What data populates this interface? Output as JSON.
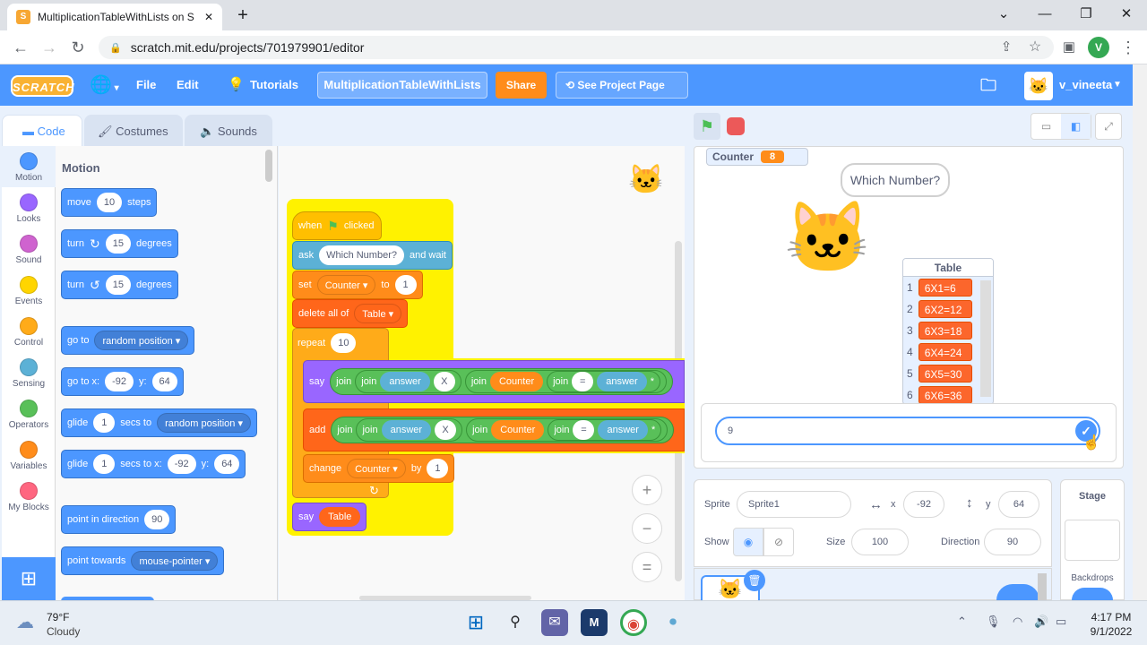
{
  "browser": {
    "tab_title": "MultiplicationTableWithLists on S",
    "tab_close": "✕",
    "new_tab": "+",
    "url": "scratch.mit.edu/projects/701979901/editor",
    "profile_initial": "V",
    "window_controls": [
      "⌄",
      "—",
      "❐",
      "✕"
    ]
  },
  "menubar": {
    "logo": "SCRATCH",
    "file": "File",
    "edit": "Edit",
    "tutorials": "Tutorials",
    "project_title": "MultiplicationTableWithLists",
    "share": "Share",
    "see_project_page": "See Project Page",
    "username": "v_vineeta"
  },
  "editor_tabs": {
    "code": "Code",
    "costumes": "Costumes",
    "sounds": "Sounds"
  },
  "categories": [
    {
      "label": "Motion",
      "color": "#4c97ff"
    },
    {
      "label": "Looks",
      "color": "#9966ff"
    },
    {
      "label": "Sound",
      "color": "#cf63cf"
    },
    {
      "label": "Events",
      "color": "#ffd500"
    },
    {
      "label": "Control",
      "color": "#ffab19"
    },
    {
      "label": "Sensing",
      "color": "#5cb1d6"
    },
    {
      "label": "Operators",
      "color": "#59c059"
    },
    {
      "label": "Variables",
      "color": "#ff8c1a"
    },
    {
      "label": "My Blocks",
      "color": "#ff6680"
    }
  ],
  "palette": {
    "heading": "Motion",
    "move": {
      "a": "move",
      "n": "10",
      "b": "steps"
    },
    "turn_cw": {
      "a": "turn",
      "n": "15",
      "b": "degrees"
    },
    "turn_ccw": {
      "a": "turn",
      "n": "15",
      "b": "degrees"
    },
    "goto": {
      "a": "go to",
      "d": "random position"
    },
    "gotoxy": {
      "a": "go to x:",
      "x": "-92",
      "b": "y:",
      "y": "64"
    },
    "glide": {
      "a": "glide",
      "n": "1",
      "b": "secs to",
      "d": "random position"
    },
    "glidexy": {
      "a": "glide",
      "n": "1",
      "b": "secs to x:",
      "x": "-92",
      "c": "y:",
      "y": "64"
    },
    "point_dir": {
      "a": "point in direction",
      "n": "90"
    },
    "point_towards": {
      "a": "point towards",
      "d": "mouse-pointer"
    }
  },
  "script": {
    "when": "when",
    "clicked": "clicked",
    "ask": "ask",
    "ask_text": "Which Number?",
    "and_wait": "and wait",
    "set": "set",
    "set_var": "Counter",
    "to": "to",
    "set_val": "1",
    "delete_all": "delete all of",
    "delete_list": "Table",
    "repeat": "repeat",
    "repeat_n": "10",
    "say": "say",
    "join": "join",
    "answer": "answer",
    "x": "X",
    "counter": "Counter",
    "eq": "=",
    "star": "*",
    "add": "add",
    "change": "change",
    "change_var": "Counter",
    "by": "by",
    "change_val": "1",
    "say2": "say",
    "say2_list": "Table"
  },
  "zoom": {
    "in": "+",
    "out": "−",
    "reset": "="
  },
  "stage": {
    "counter_label": "Counter",
    "counter_value": "8",
    "speech": "Which Number?",
    "list_title": "Table",
    "list_items": [
      {
        "i": "1",
        "v": "6X1=6"
      },
      {
        "i": "2",
        "v": "6X2=12"
      },
      {
        "i": "3",
        "v": "6X3=18"
      },
      {
        "i": "4",
        "v": "6X4=24"
      },
      {
        "i": "5",
        "v": "6X5=30"
      },
      {
        "i": "6",
        "v": "6X6=36"
      }
    ],
    "ask_input_value": "9",
    "check": "✓"
  },
  "sprite_info": {
    "sprite_label": "Sprite",
    "sprite_name": "Sprite1",
    "x_label": "x",
    "x_value": "-92",
    "y_label": "y",
    "y_value": "64",
    "show_label": "Show",
    "size_label": "Size",
    "size_value": "100",
    "direction_label": "Direction",
    "direction_value": "90"
  },
  "stage_panel": {
    "title": "Stage",
    "backdrops": "Backdrops"
  },
  "taskbar": {
    "weather_temp": "79°F",
    "weather_desc": "Cloudy",
    "time": "4:17 PM",
    "date": "9/1/2022"
  }
}
